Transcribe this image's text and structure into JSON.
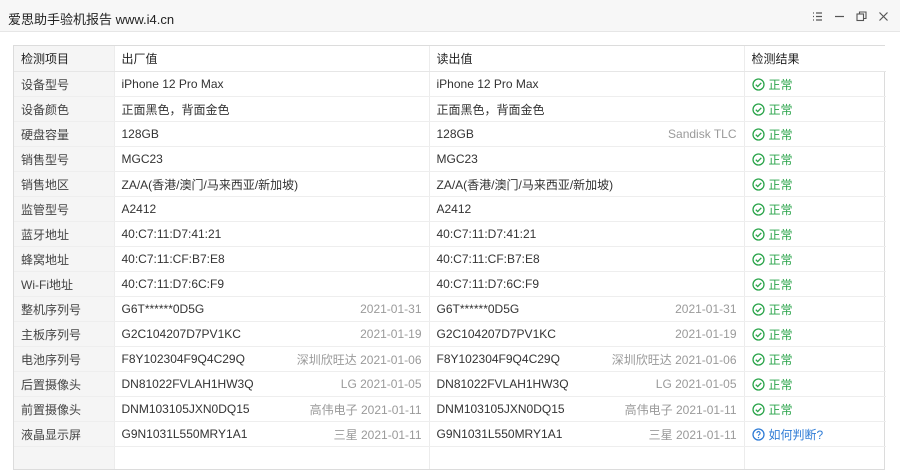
{
  "window": {
    "title": "爱思助手验机报告 www.i4.cn"
  },
  "table": {
    "headers": [
      "检测项目",
      "出厂值",
      "读出值",
      "检测结果"
    ],
    "rows": [
      {
        "item": "设备型号",
        "factory": "iPhone 12 Pro Max",
        "factory_meta": "",
        "read": "iPhone 12 Pro Max",
        "read_meta": "",
        "result": "正常",
        "status": "ok"
      },
      {
        "item": "设备颜色",
        "factory": "正面黑色，背面金色",
        "factory_meta": "",
        "read": "正面黑色，背面金色",
        "read_meta": "",
        "result": "正常",
        "status": "ok"
      },
      {
        "item": "硬盘容量",
        "factory": "128GB",
        "factory_meta": "",
        "read": "128GB",
        "read_meta": "Sandisk TLC",
        "result": "正常",
        "status": "ok"
      },
      {
        "item": "销售型号",
        "factory": "MGC23",
        "factory_meta": "",
        "read": "MGC23",
        "read_meta": "",
        "result": "正常",
        "status": "ok"
      },
      {
        "item": "销售地区",
        "factory": "ZA/A(香港/澳门/马来西亚/新加坡)",
        "factory_meta": "",
        "read": "ZA/A(香港/澳门/马来西亚/新加坡)",
        "read_meta": "",
        "result": "正常",
        "status": "ok"
      },
      {
        "item": "监管型号",
        "factory": "A2412",
        "factory_meta": "",
        "read": "A2412",
        "read_meta": "",
        "result": "正常",
        "status": "ok"
      },
      {
        "item": "蓝牙地址",
        "factory": "40:C7:11:D7:41:21",
        "factory_meta": "",
        "read": "40:C7:11:D7:41:21",
        "read_meta": "",
        "result": "正常",
        "status": "ok"
      },
      {
        "item": "蜂窝地址",
        "factory": "40:C7:11:CF:B7:E8",
        "factory_meta": "",
        "read": "40:C7:11:CF:B7:E8",
        "read_meta": "",
        "result": "正常",
        "status": "ok"
      },
      {
        "item": "Wi-Fi地址",
        "factory": "40:C7:11:D7:6C:F9",
        "factory_meta": "",
        "read": "40:C7:11:D7:6C:F9",
        "read_meta": "",
        "result": "正常",
        "status": "ok"
      },
      {
        "item": "整机序列号",
        "factory": "G6T******0D5G",
        "factory_meta": "2021-01-31",
        "read": "G6T******0D5G",
        "read_meta": "2021-01-31",
        "result": "正常",
        "status": "ok"
      },
      {
        "item": "主板序列号",
        "factory": "G2C104207D7PV1KC",
        "factory_meta": "2021-01-19",
        "read": "G2C104207D7PV1KC",
        "read_meta": "2021-01-19",
        "result": "正常",
        "status": "ok"
      },
      {
        "item": "电池序列号",
        "factory": "F8Y102304F9Q4C29Q",
        "factory_meta": "深圳欣旺达 2021-01-06",
        "read": "F8Y102304F9Q4C29Q",
        "read_meta": "深圳欣旺达 2021-01-06",
        "result": "正常",
        "status": "ok"
      },
      {
        "item": "后置摄像头",
        "factory": "DN81022FVLAH1HW3Q",
        "factory_meta": "LG 2021-01-05",
        "read": "DN81022FVLAH1HW3Q",
        "read_meta": "LG 2021-01-05",
        "result": "正常",
        "status": "ok"
      },
      {
        "item": "前置摄像头",
        "factory": "DNM103105JXN0DQ15",
        "factory_meta": "高伟电子 2021-01-11",
        "read": "DNM103105JXN0DQ15",
        "read_meta": "高伟电子 2021-01-11",
        "result": "正常",
        "status": "ok"
      },
      {
        "item": "液晶显示屏",
        "factory": "G9N1031L550MRY1A1",
        "factory_meta": "三星 2021-01-11",
        "read": "G9N1031L550MRY1A1",
        "read_meta": "三星 2021-01-11",
        "result": "如何判断?",
        "status": "help"
      }
    ]
  },
  "colors": {
    "ok": "#2aa44a",
    "help": "#2f7cd6"
  },
  "icons": {
    "ok": "check-circle-icon",
    "help": "question-circle-icon"
  }
}
